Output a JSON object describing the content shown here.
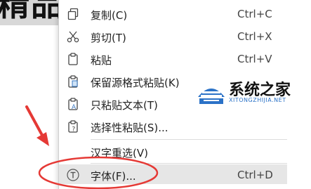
{
  "background": {
    "doc_text": "精品"
  },
  "menu": {
    "items": [
      {
        "label": "复制(C)",
        "shortcut": "Ctrl+C",
        "icon": "copy-icon"
      },
      {
        "label": "剪切(T)",
        "shortcut": "Ctrl+X",
        "icon": "scissors-icon"
      },
      {
        "label": "粘贴",
        "shortcut": "Ctrl+V",
        "icon": "clipboard-icon"
      },
      {
        "label": "保留源格式粘贴(K)",
        "shortcut": "",
        "icon": "paste-keep-format-icon"
      },
      {
        "label": "只粘贴文本(T)",
        "shortcut": "",
        "icon": "paste-text-only-icon"
      },
      {
        "label": "选择性粘贴(S)...",
        "shortcut": "",
        "icon": "paste-special-icon"
      },
      {
        "label": "汉字重选(V)",
        "shortcut": "",
        "icon": ""
      },
      {
        "label": "字体(F)...",
        "shortcut": "Ctrl+D",
        "icon": "font-icon"
      }
    ]
  },
  "watermark": {
    "name": "系统之家",
    "url": "XITONGZHIJIA.NET"
  },
  "colors": {
    "annotation_red": "#e53935",
    "highlight": "#e6e6e6",
    "watermark_blue": "#2b72c7"
  }
}
